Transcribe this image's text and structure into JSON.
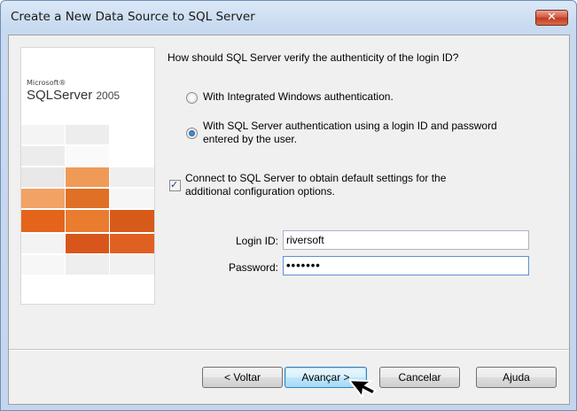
{
  "window": {
    "title": "Create a New Data Source to SQL Server"
  },
  "logo": {
    "microsoft": "Microsoft®",
    "product": "SQLServer",
    "version": "2005"
  },
  "form": {
    "question": "How should SQL Server verify the authenticity of the login ID?",
    "auth_options": [
      {
        "label": "With Integrated Windows authentication.",
        "selected": false
      },
      {
        "label_line1": "With SQL Server authentication using a login ID and password",
        "label_line2": "entered by the user.",
        "selected": true
      }
    ],
    "connect_checkbox": {
      "line1": "Connect to SQL Server to obtain default settings for the",
      "line2": "additional configuration options.",
      "checked": true
    },
    "login_label": "Login ID:",
    "login_value": "riversoft",
    "password_label": "Password:",
    "password_value": "•••••••"
  },
  "buttons": {
    "back": "< Voltar",
    "next": "Avançar >",
    "cancel": "Cancelar",
    "help": "Ajuda"
  },
  "colors": {
    "accent": "#d2533b",
    "tile_orange": "#e8742a",
    "tile_dark": "#d4561c"
  }
}
